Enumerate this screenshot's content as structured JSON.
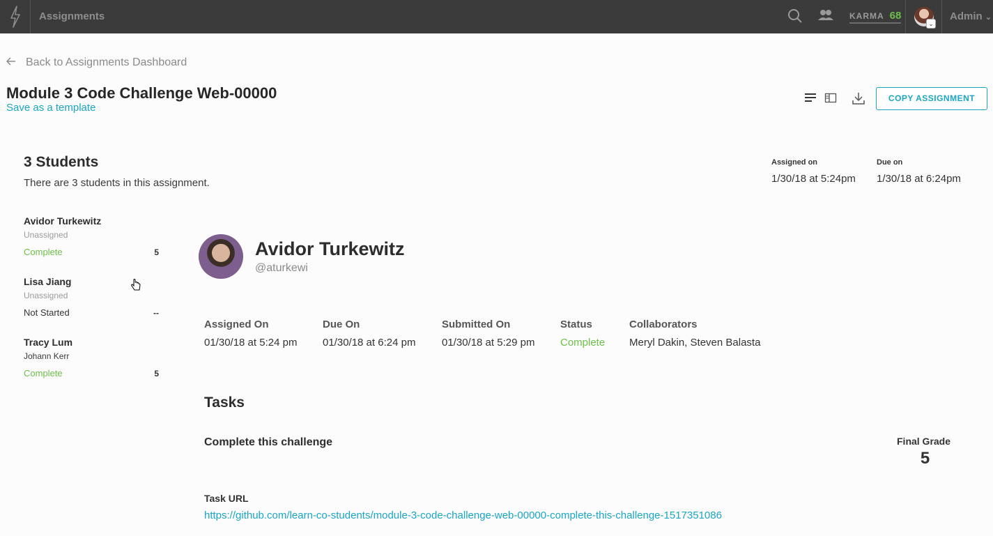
{
  "topbar": {
    "title": "Assignments",
    "karma_label": "KARMA",
    "karma_value": "68",
    "admin_label": "Admin"
  },
  "header": {
    "back_label": "Back to Assignments Dashboard",
    "title": "Module 3 Code Challenge Web-00000",
    "save_template": "Save as a template",
    "copy_button": "COPY ASSIGNMENT"
  },
  "summary": {
    "students_title": "3 Students",
    "students_desc": "There are 3 students in this assignment.",
    "assigned_on_label": "Assigned on",
    "assigned_on_value": "1/30/18 at 5:24pm",
    "due_on_label": "Due on",
    "due_on_value": "1/30/18 at 6:24pm"
  },
  "students": [
    {
      "name": "Avidor Turkewitz",
      "assignee": "Unassigned",
      "status": "Complete",
      "score": "5"
    },
    {
      "name": "Lisa Jiang",
      "assignee": "Unassigned",
      "status": "Not Started",
      "score": "--"
    },
    {
      "name": "Tracy Lum",
      "assignee": "Johann Kerr",
      "status": "Complete",
      "score": "5"
    }
  ],
  "detail": {
    "name": "Avidor Turkewitz",
    "handle": "@aturkewi",
    "columns": [
      {
        "label": "Assigned On",
        "value": "01/30/18 at 5:24 pm"
      },
      {
        "label": "Due On",
        "value": "01/30/18 at 6:24 pm"
      },
      {
        "label": "Submitted On",
        "value": "01/30/18 at 5:29 pm"
      },
      {
        "label": "Status",
        "value": "Complete"
      },
      {
        "label": "Collaborators",
        "value": "Meryl Dakin, Steven Balasta"
      }
    ],
    "tasks_title": "Tasks",
    "task_name": "Complete this challenge",
    "final_grade_label": "Final Grade",
    "final_grade_value": "5",
    "task_url_label": "Task URL",
    "task_url": "https://github.com/learn-co-students/module-3-code-challenge-web-00000-complete-this-challenge-1517351086"
  },
  "colors": {
    "accent": "#1aa6c4",
    "complete": "#6cc04a",
    "topbar": "#3b3b3b"
  }
}
